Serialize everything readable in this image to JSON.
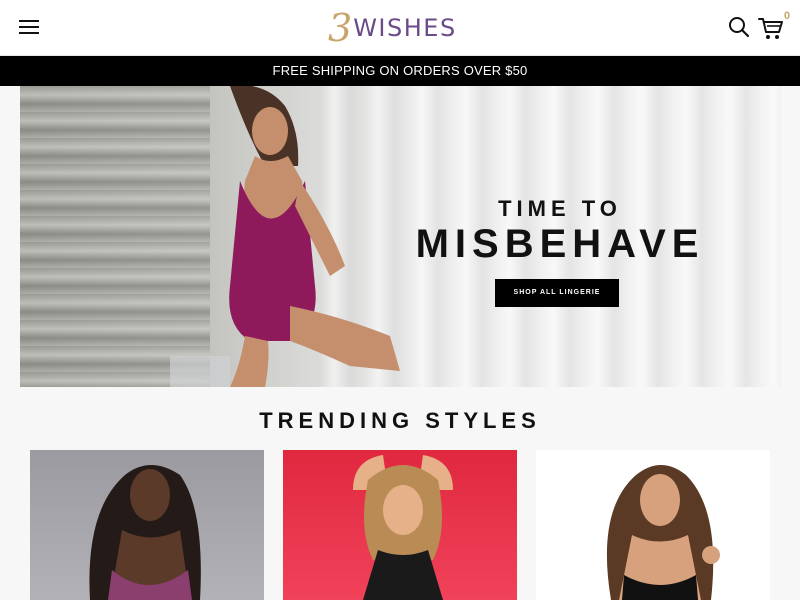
{
  "header": {
    "logo_mark": "3",
    "logo_text": "WISHES",
    "cart_count": "0"
  },
  "promo": {
    "text": "FREE SHIPPING ON ORDERS OVER $50"
  },
  "hero": {
    "heading_small": "TIME TO",
    "heading_big": "MISBEHAVE",
    "cta_label": "SHOP ALL LINGERIE"
  },
  "trending": {
    "title": "TRENDING STYLES"
  },
  "icons": {
    "menu": "hamburger-menu-icon",
    "search": "search-icon",
    "cart": "shopping-cart-icon"
  },
  "colors": {
    "brand_gold": "#c9a46a",
    "brand_purple": "#6b4a8a",
    "promo_bg": "#000000",
    "card2_bg": "#e0283f"
  }
}
